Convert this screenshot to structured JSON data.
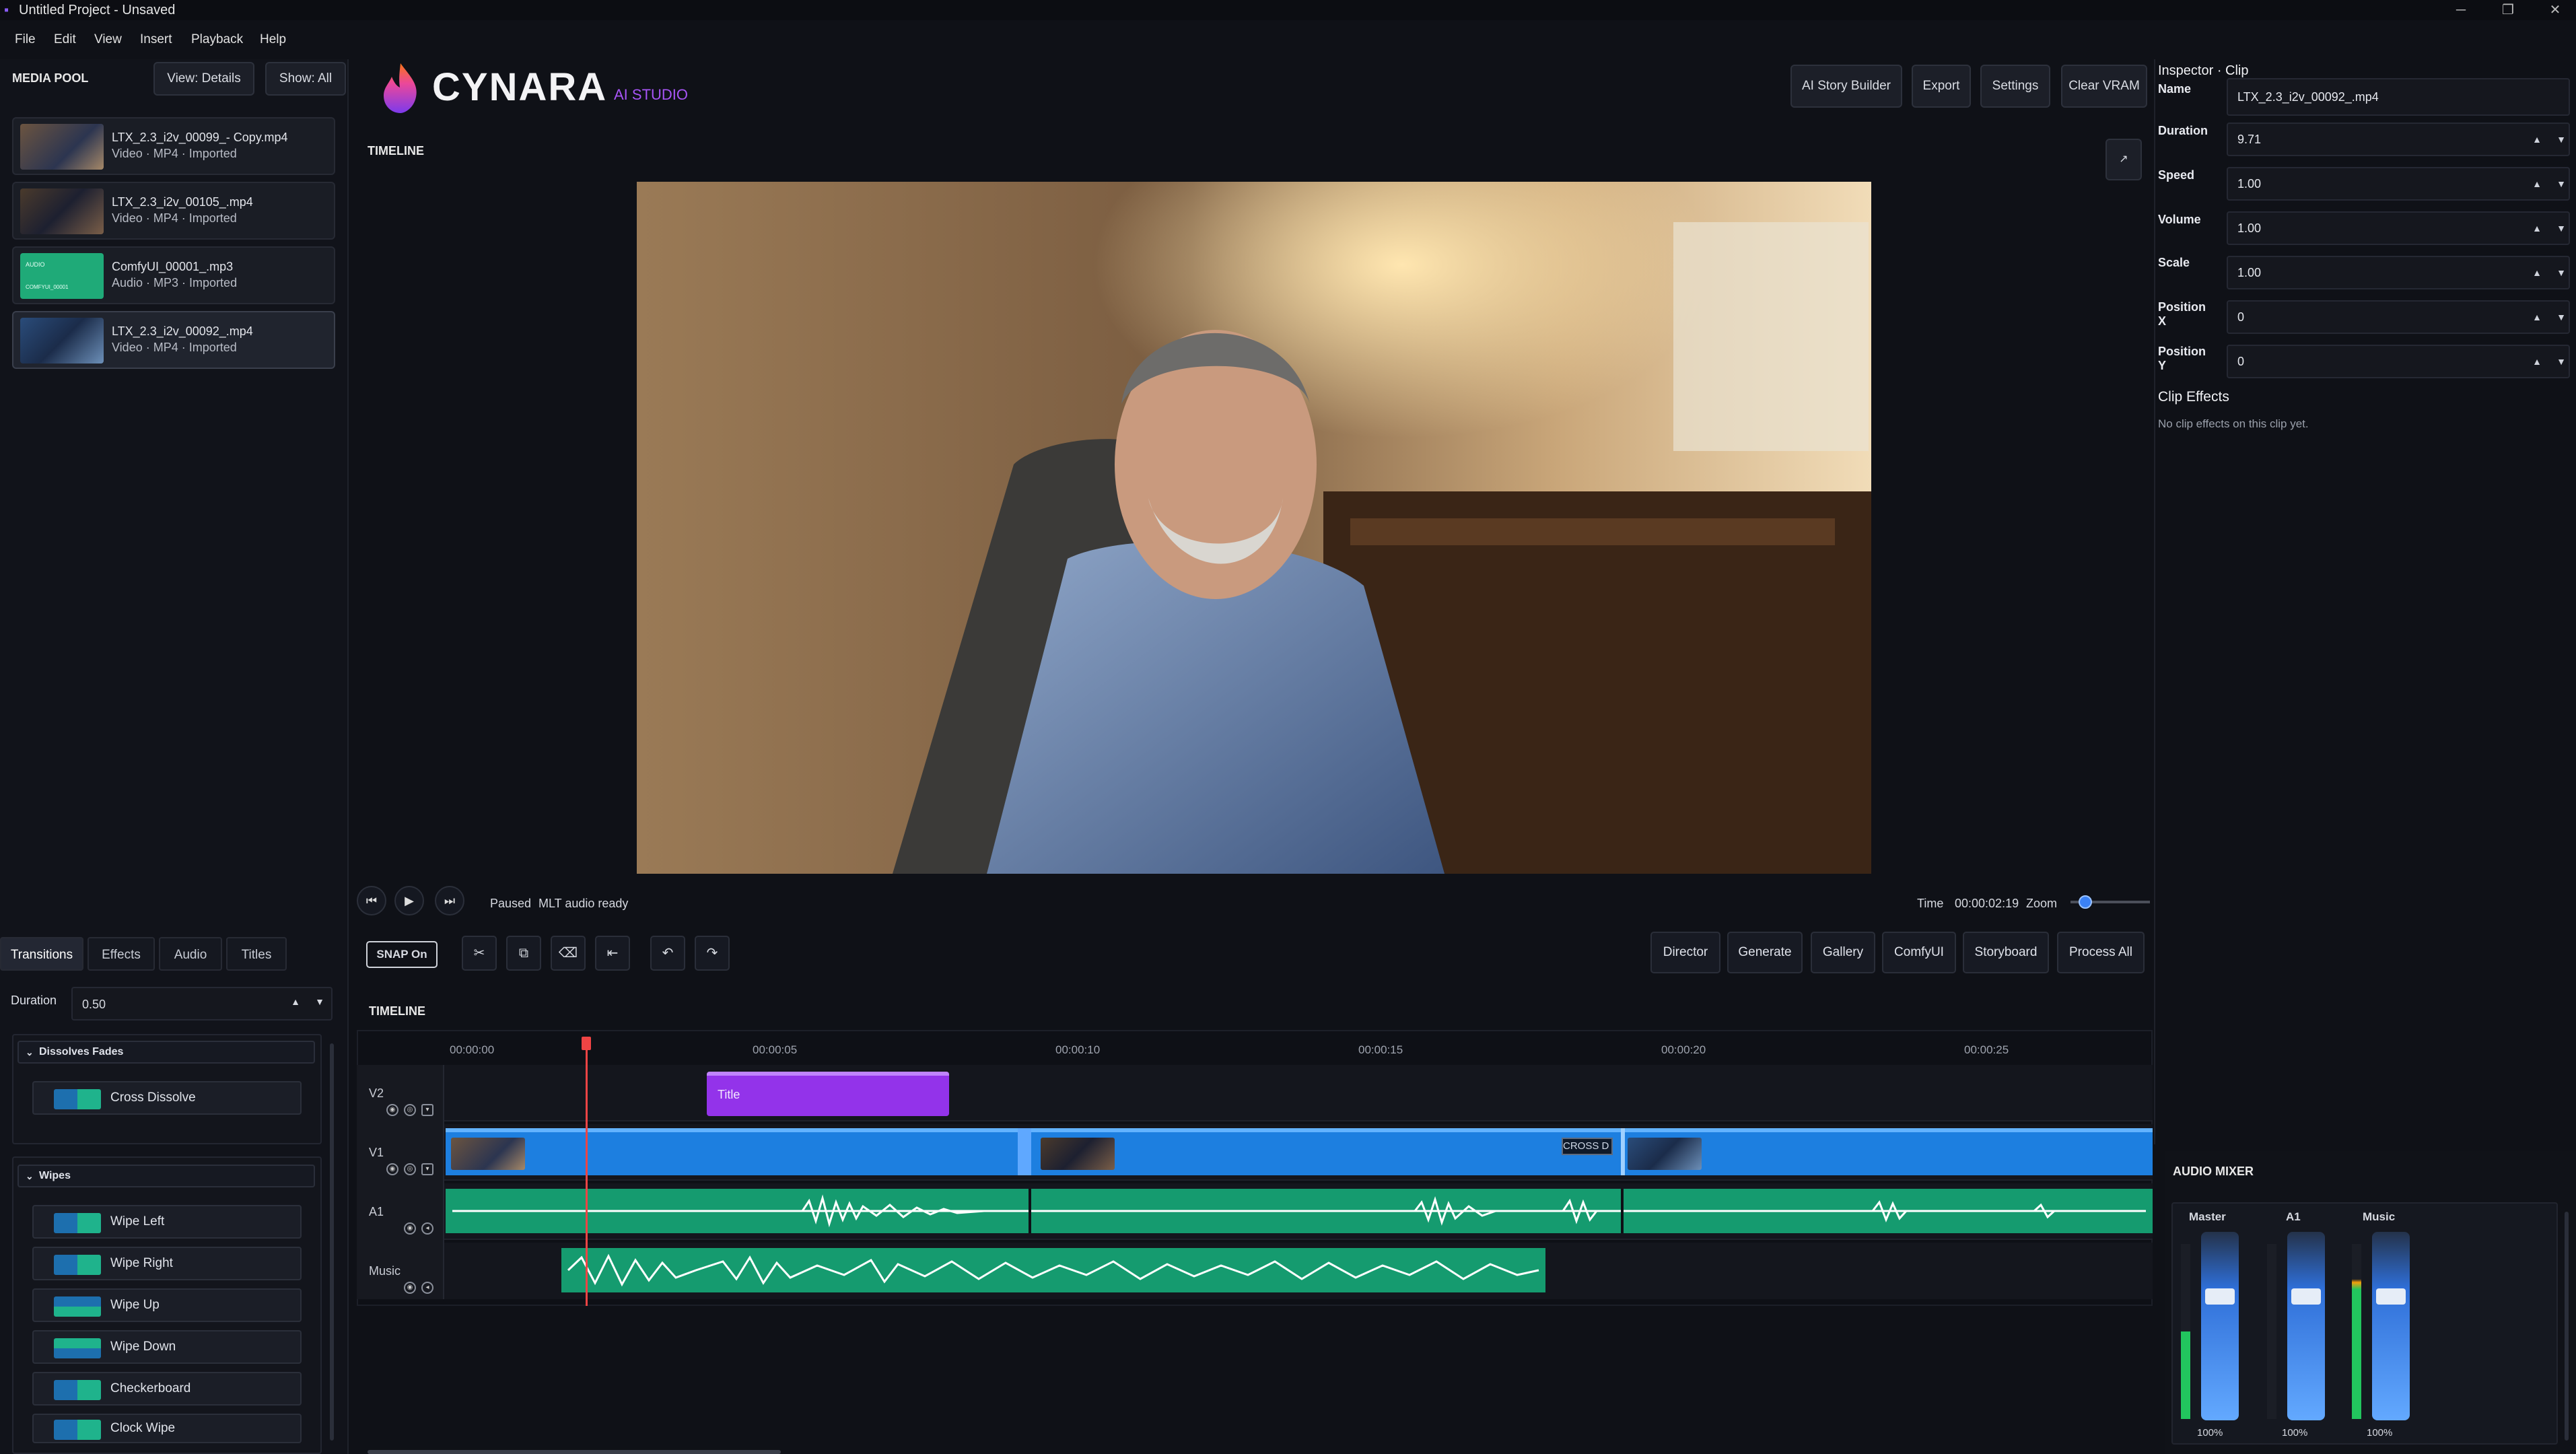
{
  "window": {
    "title": "Untitled Project - Unsaved",
    "minimize": "─",
    "maximize": "❐",
    "close": "✕"
  },
  "menu": [
    "File",
    "Edit",
    "View",
    "Insert",
    "Playback",
    "Help"
  ],
  "media_pool": {
    "title": "MEDIA POOL",
    "view": "View: Details",
    "show": "Show: All",
    "items": [
      {
        "name": "LTX_2.3_i2v_00099_- Copy.mp4",
        "meta": "Video · MP4 · Imported"
      },
      {
        "name": "LTX_2.3_i2v_00105_.mp4",
        "meta": "Video · MP4 · Imported"
      },
      {
        "name": "ComfyUI_00001_.mp3",
        "meta": "Audio · MP3 · Imported",
        "thumb_text": "AUDIO",
        "thumb_sub": "COMFYUI_00001"
      },
      {
        "name": "LTX_2.3_i2v_00092_.mp4",
        "meta": "Video · MP4 · Imported"
      }
    ]
  },
  "left_tabs": [
    "Transitions",
    "Effects",
    "Audio",
    "Titles"
  ],
  "transitions": {
    "duration_label": "Duration",
    "duration_value": "0.50",
    "section1": "Dissolves  Fades",
    "section1_items": [
      "Cross Dissolve"
    ],
    "section2": "Wipes",
    "section2_items": [
      "Wipe Left",
      "Wipe Right",
      "Wipe Up",
      "Wipe Down",
      "Checkerboard",
      "Clock Wipe"
    ]
  },
  "brand": {
    "name": "CYNARA",
    "sub": "AI STUDIO"
  },
  "top_buttons": [
    "AI Story Builder",
    "Export",
    "Settings",
    "Clear VRAM"
  ],
  "preview": {
    "header": "TIMELINE",
    "status": "Paused",
    "audio": "MLT audio ready",
    "time_label": "Time",
    "time_value": "00:00:02:19",
    "zoom_label": "Zoom"
  },
  "toolbar": {
    "snap": "SNAP  On",
    "right_buttons": [
      "Director",
      "Generate",
      "Gallery",
      "ComfyUI",
      "Storyboard",
      "Process All"
    ]
  },
  "timeline": {
    "header": "TIMELINE",
    "ruler": [
      "00:00:00",
      "00:00:05",
      "00:00:10",
      "00:00:15",
      "00:00:20",
      "00:00:25"
    ],
    "tracks": [
      "V2",
      "V1",
      "A1",
      "Music"
    ],
    "title_clip": "Title",
    "cross_label": "CROSS D"
  },
  "inspector": {
    "title": "Inspector · Clip",
    "fields": [
      {
        "label": "Name",
        "value": "LTX_2.3_i2v_00092_.mp4"
      },
      {
        "label": "Duration",
        "value": "9.71"
      },
      {
        "label": "Speed",
        "value": "1.00"
      },
      {
        "label": "Volume",
        "value": "1.00"
      },
      {
        "label": "Scale",
        "value": "1.00"
      },
      {
        "label": "Position X",
        "value": "0"
      },
      {
        "label": "Position Y",
        "value": "0"
      }
    ],
    "effects_title": "Clip Effects",
    "effects_empty": "No clip effects on this clip yet."
  },
  "mixer": {
    "title": "AUDIO MIXER",
    "channels": [
      {
        "name": "Master",
        "value": "100%"
      },
      {
        "name": "A1",
        "value": "100%"
      },
      {
        "name": "Music",
        "value": "100%"
      }
    ]
  }
}
